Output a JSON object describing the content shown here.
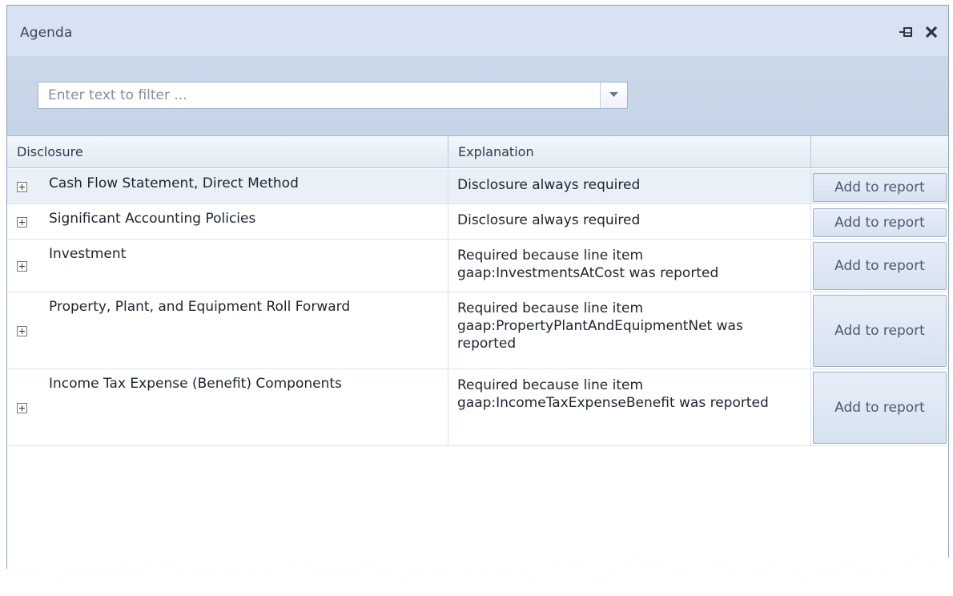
{
  "panel": {
    "title": "Agenda",
    "pin_icon": "pin-icon",
    "close_icon": "close-icon"
  },
  "filter": {
    "placeholder": "Enter text to filter ...",
    "value": "",
    "dropdown_icon": "chevron-down-icon"
  },
  "grid": {
    "columns": {
      "disclosure": "Disclosure",
      "explanation": "Explanation",
      "action": ""
    },
    "rows": [
      {
        "disclosure": "Cash Flow Statement, Direct Method",
        "explanation": "Disclosure always required",
        "action": "Add to report"
      },
      {
        "disclosure": "Significant Accounting Policies",
        "explanation": "Disclosure always required",
        "action": "Add to report"
      },
      {
        "disclosure": "Investment",
        "explanation": "Required because line item gaap:InvestmentsAtCost was reported",
        "action": "Add to report"
      },
      {
        "disclosure": "Property, Plant, and Equipment Roll Forward",
        "explanation": "Required because line item gaap:PropertyPlantAndEquipmentNet was reported",
        "action": "Add to report"
      },
      {
        "disclosure": "Income Tax Expense (Benefit) Components",
        "explanation": "Required because line item gaap:IncomeTaxExpenseBenefit was reported",
        "action": "Add to report"
      }
    ]
  },
  "colors": {
    "panel_background": "#cfdcec",
    "selected_row": "#eaf0f8",
    "button_border": "#9fb2cb"
  }
}
